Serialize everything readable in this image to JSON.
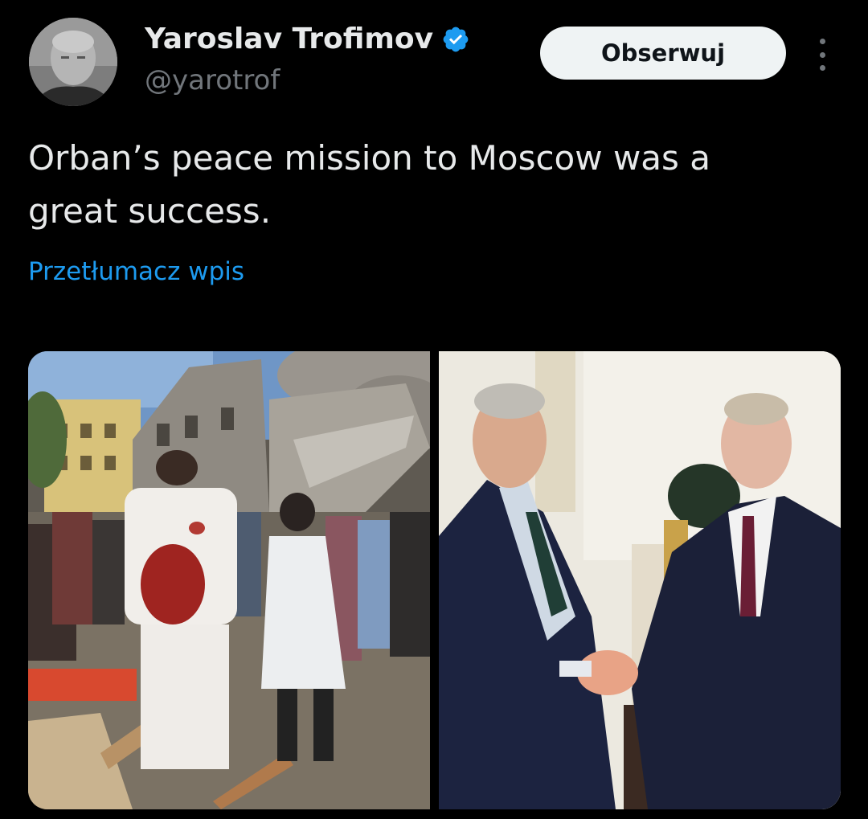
{
  "author": {
    "display_name": "Yaroslav Trofimov",
    "handle": "@yarotrof",
    "verified": true,
    "avatar_icon": "profile-photo"
  },
  "actions": {
    "follow_label": "Obserwuj",
    "more_icon": "more-vertical-icon"
  },
  "tweet": {
    "text": "Orban’s peace mission to Moscow was a\ngreat success.",
    "translate_label": "Przetłumacz wpis"
  },
  "media": {
    "count": 2
  },
  "colors": {
    "background": "#000000",
    "text": "#e7e9ea",
    "secondary_text": "#71767b",
    "link": "#1d9bf0",
    "verified_badge": "#1d9bf0",
    "follow_button_bg": "#eff3f4"
  }
}
